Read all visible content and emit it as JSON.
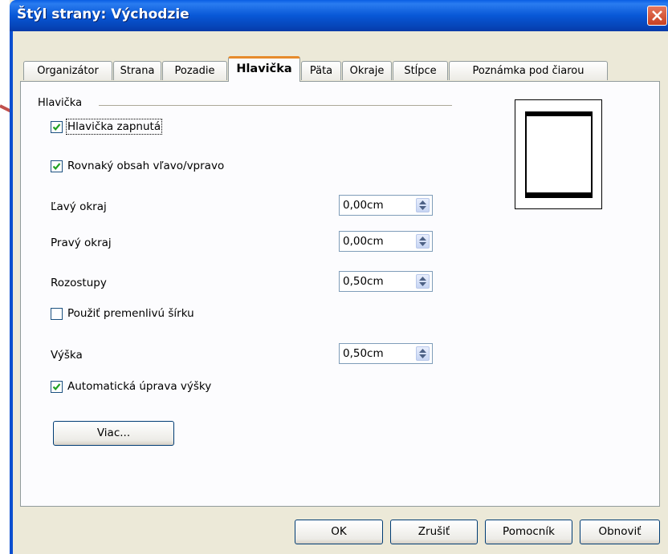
{
  "window": {
    "title": "Štýl strany: Východzie"
  },
  "tabs": [
    {
      "label": "Organizátor"
    },
    {
      "label": "Strana"
    },
    {
      "label": "Pozadie"
    },
    {
      "label": "Hlavička",
      "active": true
    },
    {
      "label": "Päta"
    },
    {
      "label": "Okraje"
    },
    {
      "label": "Stĺpce"
    },
    {
      "label": "Poznámka pod čiarou"
    }
  ],
  "header_section": {
    "title": "Hlavička",
    "header_on": {
      "label": "Hlavička zapnutá",
      "checked": true
    },
    "same_content": {
      "label": "Rovnaký obsah vľavo/vpravo",
      "checked": true
    },
    "left_margin": {
      "label": "Ľavý okraj",
      "value": "0,00cm"
    },
    "right_margin": {
      "label": "Pravý okraj",
      "value": "0,00cm"
    },
    "spacing": {
      "label": "Rozostupy",
      "value": "0,50cm"
    },
    "dynamic_spacing": {
      "label": "Použiť premenlivú šírku",
      "checked": false
    },
    "height": {
      "label": "Výška",
      "value": "0,50cm"
    },
    "autofit_height": {
      "label": "Automatická úprava výšky",
      "checked": true
    },
    "more_button": "Viac..."
  },
  "buttons": {
    "ok": "OK",
    "cancel": "Zrušiť",
    "help": "Pomocník",
    "reset": "Obnoviť"
  },
  "colors": {
    "titlebar": "#0857d6",
    "active_tab_accent": "#e68b2c",
    "annotation_arrow": "#c0504d",
    "close_button": "#d5552f"
  }
}
